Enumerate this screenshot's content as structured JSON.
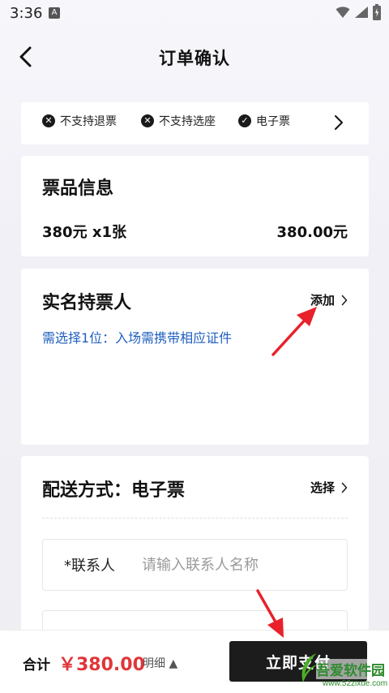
{
  "status_bar": {
    "time": "3:36",
    "notif_badge": "A"
  },
  "nav": {
    "title": "订单确认"
  },
  "tags": {
    "items": [
      {
        "icon": "x-circle-icon",
        "glyph": "✕",
        "label": "不支持退票"
      },
      {
        "icon": "x-circle-icon",
        "glyph": "✕",
        "label": "不支持选座"
      },
      {
        "icon": "check-circle-icon",
        "glyph": "✓",
        "label": "电子票"
      }
    ]
  },
  "ticket_info": {
    "title": "票品信息",
    "line": "380元 x1张",
    "amount": "380.00元"
  },
  "holder": {
    "title": "实名持票人",
    "add_label": "添加",
    "hint": "需选择1位：入场需携带相应证件"
  },
  "delivery": {
    "title": "配送方式：电子票",
    "select_label": "选择",
    "contact_label": "*联系人",
    "contact_placeholder": "请输入联系人名称",
    "contact_value": ""
  },
  "footer": {
    "total_label": "合计",
    "total_amount": "￥380.00",
    "detail_label": "明细 ▲",
    "pay_label": "立即支付"
  },
  "watermark": {
    "name": "吾爱软件园",
    "url": "www.52zixue.com"
  },
  "colors": {
    "accent_red": "#e0363a",
    "link_blue": "#1f5fbf",
    "pay_bg": "#1c1c1c",
    "annotation_red": "#e8212b"
  }
}
